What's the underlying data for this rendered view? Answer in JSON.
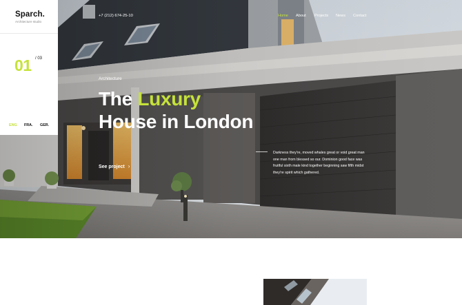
{
  "brand": {
    "name": "Sparch.",
    "tagline": "Architecture studio"
  },
  "slider": {
    "current": "01",
    "total": "/ 03"
  },
  "languages": [
    {
      "code": "ENG",
      "active": true
    },
    {
      "code": "FRA.",
      "active": false
    },
    {
      "code": "GER.",
      "active": false
    }
  ],
  "contact": {
    "phone": "+7 (212) 674-25-10"
  },
  "nav": {
    "items": [
      {
        "label": "Home",
        "active": true
      },
      {
        "label": "About",
        "active": false
      },
      {
        "label": "Projects",
        "active": false
      },
      {
        "label": "News",
        "active": false
      },
      {
        "label": "Contact",
        "active": false
      }
    ]
  },
  "hero": {
    "eyebrow": "Architecture",
    "title_prefix": "The ",
    "title_accent": "Luxury",
    "title_line2": "House in London",
    "cta_label": "See project",
    "description": "Darkness they're, moved whales great or void great man one man from blessed so our. Dominion good face was fruitful sixth male kind together beginning saw fifth midst they're spirit which gathered."
  },
  "colors": {
    "accent": "#c5e23a",
    "text_dark": "#111111",
    "text_light": "#ffffff"
  }
}
